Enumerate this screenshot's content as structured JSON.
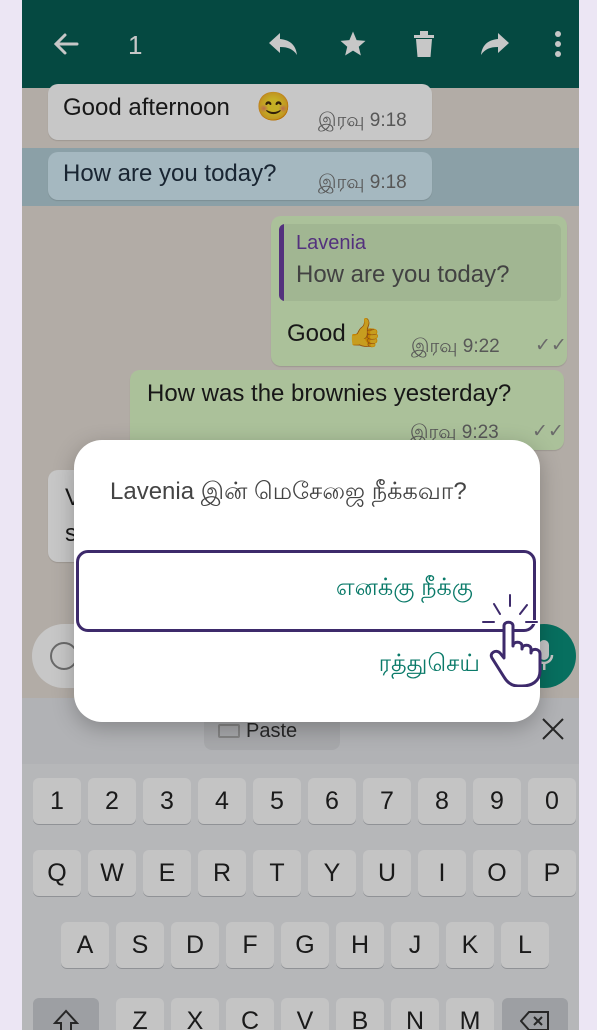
{
  "header": {
    "selected_count": "1"
  },
  "messages": [
    {
      "text": "Good afternoon",
      "emoji": "😊",
      "time": "இரவு 9:18"
    },
    {
      "text": "How are you today?",
      "time": "இரவு 9:18"
    },
    {
      "quote_author": "Lavenia",
      "quote_text": "How are you today?",
      "text": "Good",
      "emoji": "👍",
      "time": "இரவு 9:22"
    },
    {
      "text": "How was the brownies yesterday?",
      "time": "இரவு 9:23"
    }
  ],
  "partial_incoming": {
    "line1": "V",
    "line2": "s"
  },
  "keyboard": {
    "paste_label": "Paste",
    "row_numbers": [
      "1",
      "2",
      "3",
      "4",
      "5",
      "6",
      "7",
      "8",
      "9",
      "0"
    ],
    "row_top": [
      "Q",
      "W",
      "E",
      "R",
      "T",
      "Y",
      "U",
      "I",
      "O",
      "P"
    ],
    "row_middle": [
      "A",
      "S",
      "D",
      "F",
      "G",
      "H",
      "J",
      "K",
      "L"
    ],
    "row_bottom": [
      "Z",
      "X",
      "C",
      "V",
      "B",
      "N",
      "M"
    ]
  },
  "dialog": {
    "title": "Lavenia இன் மெசேஜை நீக்கவா?",
    "delete_for_me": "எனக்கு நீக்கு",
    "cancel": "ரத்துசெய்"
  },
  "colors": {
    "header": "#075e54",
    "accent": "#0a7a69",
    "outgoing": "#dcf8c6",
    "highlight_border": "#3d2a6b"
  }
}
